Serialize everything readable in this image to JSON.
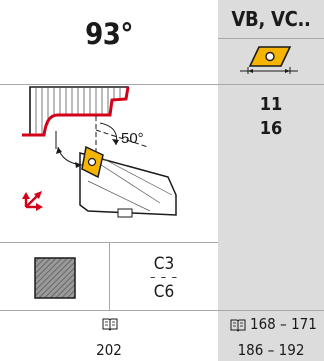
{
  "header": {
    "angle": "93°",
    "insert_codes": "VB, VC.."
  },
  "diagram": {
    "angle_annotation": "50°"
  },
  "sizes": [
    "11",
    "16"
  ],
  "quality": {
    "top": "C3",
    "bottom": "C6"
  },
  "page_refs": {
    "holder": "202",
    "insert_line1": "168 – 171",
    "insert_line2": "186 – 192"
  },
  "colors": {
    "panel_grey": "#dcdcdc",
    "insert_yellow": "#f5b400",
    "arrow_red": "#d4001a"
  },
  "icons": [
    "book-icon",
    "insert-shape-icon",
    "double-arrow-icon",
    "feed-direction-icon",
    "hatched-square-icon"
  ]
}
